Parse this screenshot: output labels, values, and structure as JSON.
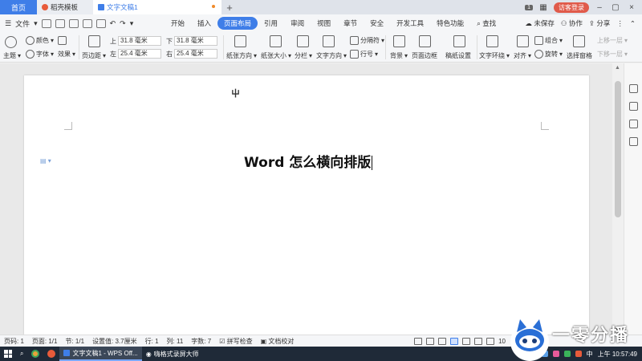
{
  "titlebar": {
    "home_tab": "首页",
    "template_tab": "稻壳模板",
    "doc_tab": "文字文稿1",
    "new_tab": "+",
    "badge": "1",
    "login": "访客登录"
  },
  "menubar": {
    "file": "文件",
    "tabs": [
      "开始",
      "插入",
      "页面布局",
      "引用",
      "审阅",
      "视图",
      "章节",
      "安全",
      "开发工具",
      "特色功能"
    ],
    "active_tab": "页面布局",
    "search": "查找",
    "unsaved": "未保存",
    "collab": "协作",
    "share": "分享"
  },
  "ribbon": {
    "theme": "主题",
    "color": "颜色",
    "font": "字体",
    "effect": "效果",
    "margin": "页边距",
    "top_label": "上",
    "top_value": "31.8 毫米",
    "bottom_label": "下",
    "bottom_value": "31.8 毫米",
    "left_label": "左",
    "left_value": "25.4 毫米",
    "right_label": "右",
    "right_value": "25.4 毫米",
    "orientation": "纸张方向",
    "size": "纸张大小",
    "columns": "分栏",
    "text_direction": "文字方向",
    "break": "分隔符",
    "line_number": "行号",
    "background": "背景",
    "page_border": "页面边框",
    "paper_setup": "稿纸设置",
    "text_wrap": "文字环绕",
    "align": "对齐",
    "group": "组合",
    "rotate": "旋转",
    "select_pane": "选择窗格",
    "bring_forward": "上移一层",
    "send_backward": "下移一层"
  },
  "document": {
    "header_mark": "屮",
    "title_text": "Word 怎么横向排版"
  },
  "statusbar": {
    "page_no": "页码: 1",
    "page_count": "页面: 1/1",
    "section": "节: 1/1",
    "setting": "设置值: 3.7厘米",
    "row": "行: 1",
    "col": "列: 11",
    "words": "字数: 7",
    "spell": "拼写检查",
    "proof": "文档校对",
    "zoom": "10"
  },
  "taskbar": {
    "app1": "文字文稿1 - WPS Off...",
    "app2": "嗨格式录屏大师",
    "ime": "中",
    "clock": "上午 10:57:49"
  },
  "watermark": {
    "text": "一零分播"
  },
  "colors": {
    "accent": "#3f7ee8",
    "login": "#e05a4a",
    "taskbar": "#1f2a38"
  }
}
